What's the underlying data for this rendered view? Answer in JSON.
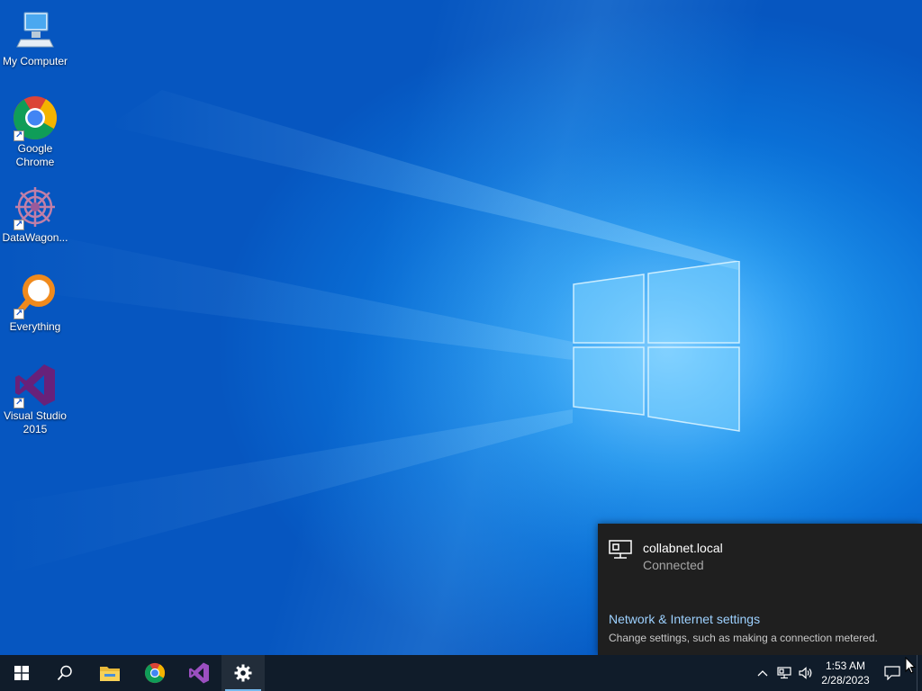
{
  "desktop": {
    "icons": [
      {
        "label": "My Computer"
      },
      {
        "label": "Google Chrome"
      },
      {
        "label": "DataWagon..."
      },
      {
        "label": "Everything"
      },
      {
        "label": "Visual Studio 2015"
      }
    ]
  },
  "network_flyout": {
    "network_name": "collabnet.local",
    "status": "Connected",
    "settings_link": "Network & Internet settings",
    "settings_description": "Change settings, such as making a connection metered."
  },
  "taskbar": {
    "buttons": [
      {
        "icon": "windows-start-icon"
      },
      {
        "icon": "search-icon"
      },
      {
        "icon": "file-explorer-icon"
      },
      {
        "icon": "chrome-icon"
      },
      {
        "icon": "visual-studio-icon"
      },
      {
        "icon": "settings-gear-icon"
      }
    ],
    "tray": {
      "icons": [
        "chevron-up-icon",
        "network-icon",
        "volume-icon",
        "notification-icon"
      ],
      "time": "1:53 AM",
      "date": "2/28/2023"
    }
  },
  "colors": {
    "desktop_blue": "#0a6fd6",
    "taskbar": "#101c2a",
    "flyout_bg": "#1f1f1f",
    "link": "#9dd1ff",
    "active_indicator": "#76b9ed"
  }
}
